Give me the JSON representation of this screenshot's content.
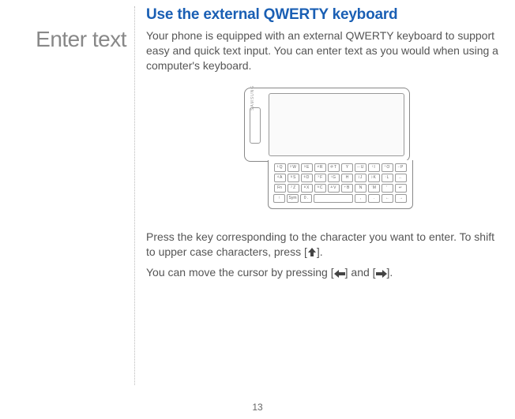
{
  "sidebar": {
    "title": "Enter text"
  },
  "content": {
    "heading": "Use the external QWERTY keyboard",
    "para1": "Your phone is equipped with an external QWERTY keyboard to support easy and quick text input. You can enter text as you would when using a computer's keyboard.",
    "para2_a": "Press the key corresponding to the character you want to enter. To shift to upper case characters, press [",
    "para2_b": "].",
    "para3_a": "You can move the cursor by pressing [",
    "para3_b": "] and [",
    "para3_c": "].",
    "brand": "SAMSUNG"
  },
  "keyboard": {
    "row1": [
      {
        "sup": "1",
        "k": "Q"
      },
      {
        "sup": "2",
        "k": "W"
      },
      {
        "sup": "3",
        "k": "E"
      },
      {
        "sup": "#",
        "k": "R"
      },
      {
        "sup": "@",
        "k": "T"
      },
      {
        "sup": "",
        "k": "Y"
      },
      {
        "sup": "—",
        "k": "U"
      },
      {
        "sup": "!",
        "k": "I"
      },
      {
        "sup": "*",
        "k": "O"
      },
      {
        "sup": "–",
        "k": "P"
      }
    ],
    "row2": [
      {
        "sup": "4",
        "k": "A"
      },
      {
        "sup": "5",
        "k": "S"
      },
      {
        "sup": "6",
        "k": "D"
      },
      {
        "sup": "?",
        "k": "F"
      },
      {
        "sup": "/",
        "k": "G"
      },
      {
        "sup": "",
        "k": "H"
      },
      {
        "sup": "(",
        "k": "J"
      },
      {
        "sup": ")",
        "k": "K"
      },
      {
        "sup": ":",
        "k": "L"
      },
      {
        "sup": "",
        "k": "←"
      }
    ],
    "row3": [
      {
        "sup": "",
        "k": "Fn"
      },
      {
        "sup": "7",
        "k": "Z"
      },
      {
        "sup": "8",
        "k": "X"
      },
      {
        "sup": "9",
        "k": "C"
      },
      {
        "sup": "&",
        "k": "V"
      },
      {
        "sup": "+",
        "k": "B"
      },
      {
        "sup": "",
        "k": "N"
      },
      {
        "sup": "'",
        "k": "M"
      },
      {
        "sup": "\"",
        "k": ""
      },
      {
        "sup": "",
        "k": "↵"
      }
    ],
    "row4": [
      {
        "k": "↑"
      },
      {
        "k": "Sym"
      },
      {
        "k": "0 ."
      },
      {
        "k": ""
      },
      {
        "k": ","
      },
      {
        "k": "."
      },
      {
        "k": "←"
      },
      {
        "k": "→"
      }
    ]
  },
  "pageNumber": "13"
}
